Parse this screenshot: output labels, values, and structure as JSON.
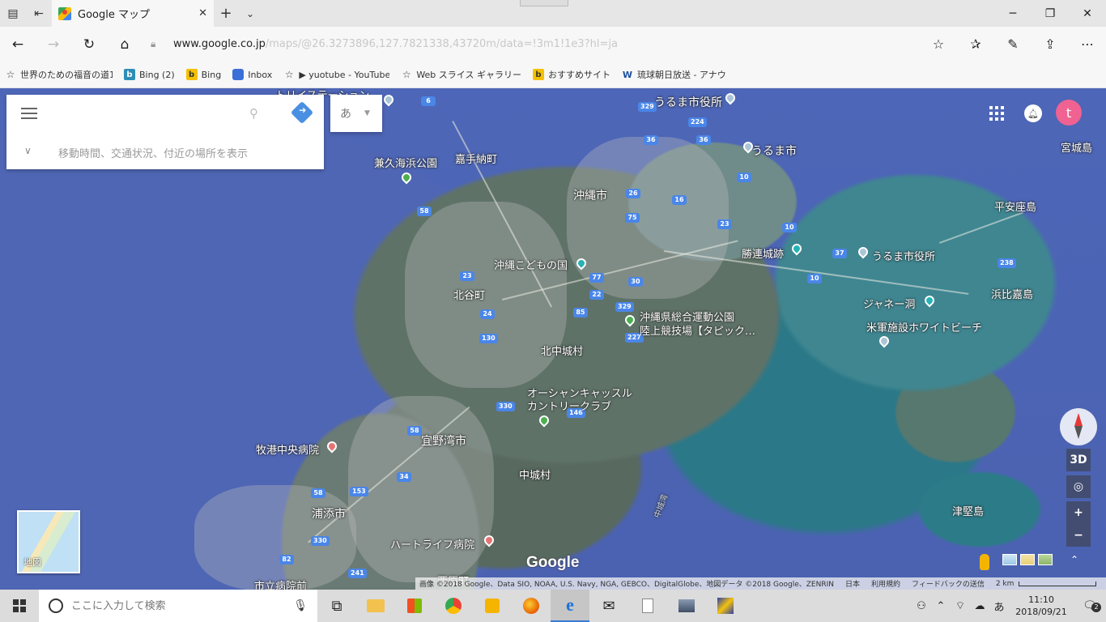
{
  "browser": {
    "tab_title": "Google マップ",
    "url_host": "www.google.co.jp",
    "url_path": "/maps/@26.3273896,127.7821338,43720m/data=!3m1!1e3?hl=ja"
  },
  "favorites": [
    {
      "icon": "star-icon",
      "label": "世界のための福音の道1"
    },
    {
      "icon": "bing-icon",
      "label": "Bing (2)"
    },
    {
      "icon": "bing-yellow-icon",
      "label": "Bing"
    },
    {
      "icon": "inbox-icon",
      "label": "Inbox"
    },
    {
      "icon": "star-icon",
      "label": "▶ yuotube - YouTube"
    },
    {
      "icon": "star-icon",
      "label": "Web スライス ギャラリー"
    },
    {
      "icon": "bing-yellow-icon",
      "label": "おすすめサイト"
    },
    {
      "icon": "w-icon",
      "label": "琉球朝日放送 - アナウ"
    }
  ],
  "search": {
    "placeholder": "",
    "hint": "移動時間、交通状況、付近の場所を表示",
    "ime": "あ"
  },
  "account": {
    "avatar_letter": "t"
  },
  "map": {
    "labels": {
      "top_station": "トリイステーション",
      "uruma_office_top": "うるま市役所",
      "uruma_city": "うるま市",
      "miyagi": "宮城島",
      "kadena": "嘉手納町",
      "kanehisa_park": "兼久海浜公園",
      "okinawa_city": "沖縄市",
      "henza": "平安座島",
      "katsuren": "勝連城跡",
      "uruma_office": "うるま市役所",
      "kodomo": "沖縄こどもの国",
      "hamahiga": "浜比嘉島",
      "chatan": "北谷町",
      "sports_park_1": "沖縄県総合運動公園",
      "sports_park_2": "陸上競技場【タピック…",
      "janee": "ジャネー洞",
      "white_beach": "米軍施設ホワイトビーチ",
      "kitanakagusuku": "北中城村",
      "ocean_castle_1": "オーシャンキャッスル",
      "ocean_castle_2": "カントリークラブ",
      "makiminato": "牧港中央病院",
      "ginowan": "宜野湾市",
      "nakagusuku": "中城村",
      "nakagusuku_bay": "中城湾",
      "tsuken": "津堅島",
      "urasoe": "浦添市",
      "heartlife": "ハートライフ病院",
      "hospital_front": "市立病院前",
      "nishihara": "西原町"
    },
    "google_logo": "Google",
    "minimap_label": "地図",
    "btn_3d": "3D",
    "zoom_in": "+",
    "zoom_out": "−",
    "attribution": "画像 ©2018 Google、Data SIO, NOAA, U.S. Navy, NGA, GEBCO、DigitalGlobe、地図データ ©2018 Google、ZENRIN",
    "country": "日本",
    "terms": "利用規約",
    "feedback": "フィードバックの送信",
    "scale": "2 km"
  },
  "taskbar": {
    "search_placeholder": "ここに入力して検索",
    "time": "11:10",
    "date": "2018/09/21",
    "ime": "あ",
    "notifications": "2"
  }
}
